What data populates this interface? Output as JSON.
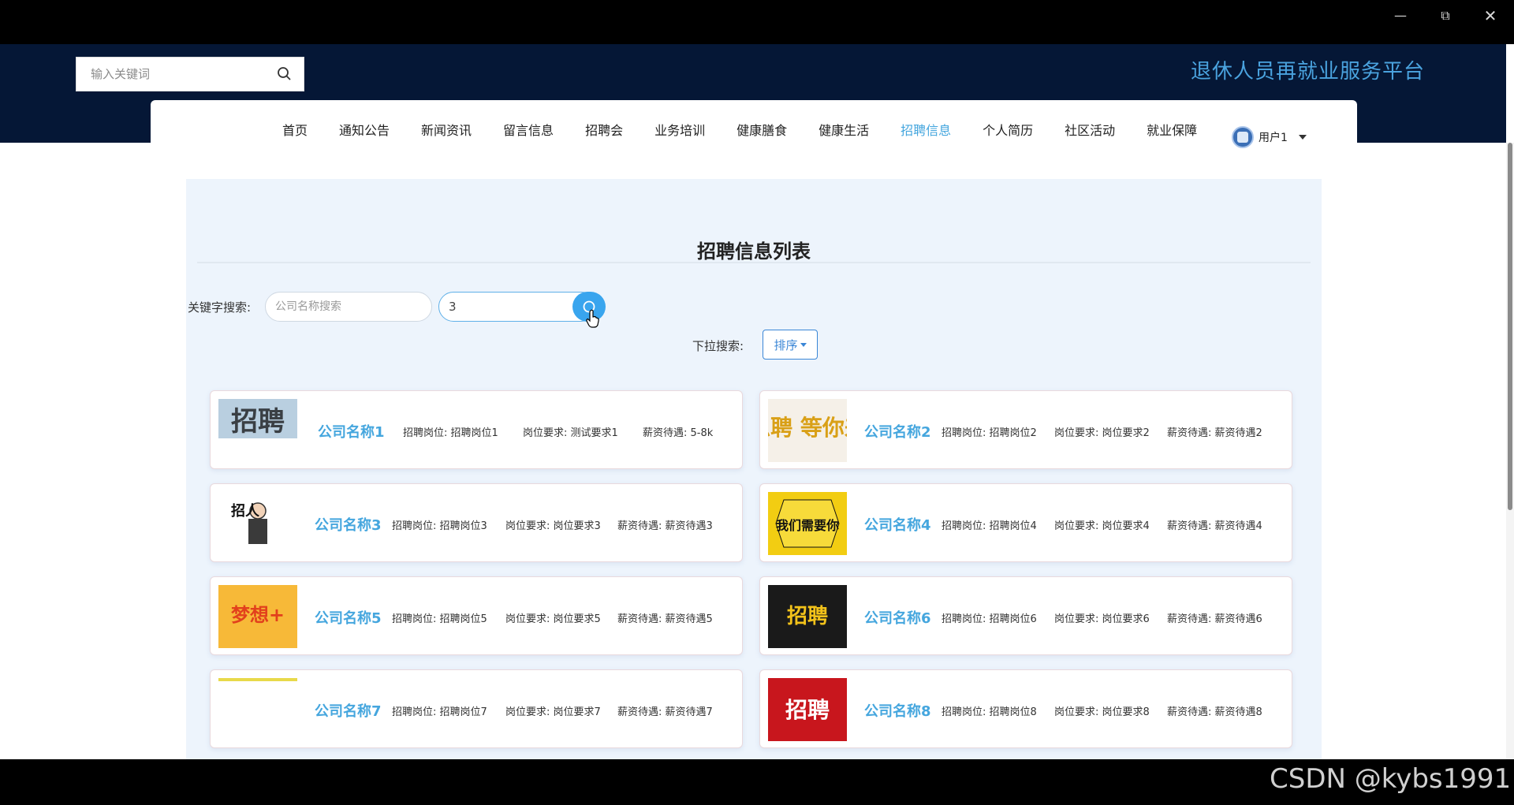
{
  "window": {
    "min_icon": "minimize-icon",
    "max_icon": "restore-icon",
    "close_icon": "close-icon"
  },
  "header": {
    "search_placeholder": "输入关键词",
    "site_title": "退休人员再就业服务平台"
  },
  "nav": {
    "items": [
      {
        "label": "首页"
      },
      {
        "label": "通知公告"
      },
      {
        "label": "新闻资讯"
      },
      {
        "label": "留言信息"
      },
      {
        "label": "招聘会"
      },
      {
        "label": "业务培训"
      },
      {
        "label": "健康膳食"
      },
      {
        "label": "健康生活"
      },
      {
        "label": "招聘信息"
      },
      {
        "label": "个人简历"
      },
      {
        "label": "社区活动"
      },
      {
        "label": "就业保障"
      }
    ],
    "active_label": "招聘信息",
    "user": "用户1"
  },
  "main": {
    "title": "招聘信息列表",
    "keyword_label": "关键字搜索:",
    "company_placeholder": "公司名称搜索",
    "second_input_value": "3",
    "dropdown_label": "下拉搜索:",
    "sort_label": "排序"
  },
  "cards": [
    {
      "name": "公司名称1",
      "position": "招聘岗位: 招聘岗位1",
      "requirement": "岗位要求: 测试要求1",
      "salary": "薪资待遇: 5-8k",
      "image_text": "招聘"
    },
    {
      "name": "公司名称2",
      "position": "招聘岗位: 招聘岗位2",
      "requirement": "岗位要求: 岗位要求2",
      "salary": "薪资待遇: 薪资待遇2",
      "image_text": "急聘 等你来"
    },
    {
      "name": "公司名称3",
      "position": "招聘岗位: 招聘岗位3",
      "requirement": "岗位要求: 岗位要求3",
      "salary": "薪资待遇: 薪资待遇3",
      "image_text": "招人"
    },
    {
      "name": "公司名称4",
      "position": "招聘岗位: 招聘岗位4",
      "requirement": "岗位要求: 岗位要求4",
      "salary": "薪资待遇: 薪资待遇4",
      "image_text": "我们需要你"
    },
    {
      "name": "公司名称5",
      "position": "招聘岗位: 招聘岗位5",
      "requirement": "岗位要求: 岗位要求5",
      "salary": "薪资待遇: 薪资待遇5",
      "image_text": "梦想+"
    },
    {
      "name": "公司名称6",
      "position": "招聘岗位: 招聘岗位6",
      "requirement": "岗位要求: 岗位要求6",
      "salary": "薪资待遇: 薪资待遇6",
      "image_text": "招聘"
    },
    {
      "name": "公司名称7",
      "position": "招聘岗位: 招聘岗位7",
      "requirement": "岗位要求: 岗位要求7",
      "salary": "薪资待遇: 薪资待遇7",
      "image_text": ""
    },
    {
      "name": "公司名称8",
      "position": "招聘岗位: 招聘岗位8",
      "requirement": "岗位要求: 岗位要求8",
      "salary": "薪资待遇: 薪资待遇8",
      "image_text": "招聘"
    }
  ],
  "watermark": "CSDN @kybs1991",
  "colors": {
    "navy": "#051736",
    "accent": "#45a6de",
    "content_bg": "#edf4fc"
  }
}
